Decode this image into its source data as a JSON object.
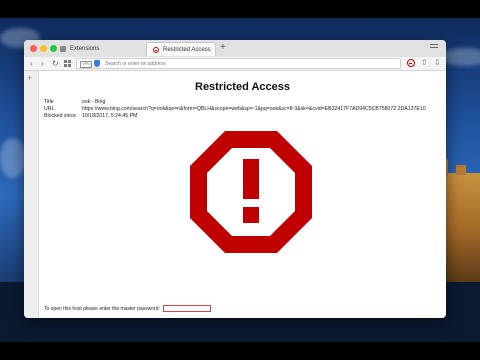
{
  "browser": {
    "tabs": [
      {
        "label": "Extensions",
        "active": false
      },
      {
        "label": "Restricted Access",
        "active": true
      }
    ],
    "new_tab_label": "+",
    "address_placeholder": "Search or enter an address",
    "vpn_label": "VPN"
  },
  "page": {
    "title": "Restricted Access",
    "fields": [
      {
        "label": "Title",
        "value": "ook - Bing"
      },
      {
        "label": "URL",
        "value": "https://www.bing.com/search?q=ook&qs=n&form=QBLH&scope=web&sp=-1&pq=ook&sc=8-3&sk=&cvid=EB32417F7AD94C5CB758072 2DA137E10"
      },
      {
        "label": "Blocked since",
        "value": "10/18/2017, 5:24:45 PM"
      }
    ],
    "password_prompt": "To open this host please enter the master password:"
  },
  "colors": {
    "warning_red": "#c00000",
    "accent_blue": "#3a7be0"
  },
  "icons": {
    "warning": "exclamation-octagon-icon",
    "blocker": "block-icon",
    "share": "share-icon",
    "download": "download-icon"
  }
}
